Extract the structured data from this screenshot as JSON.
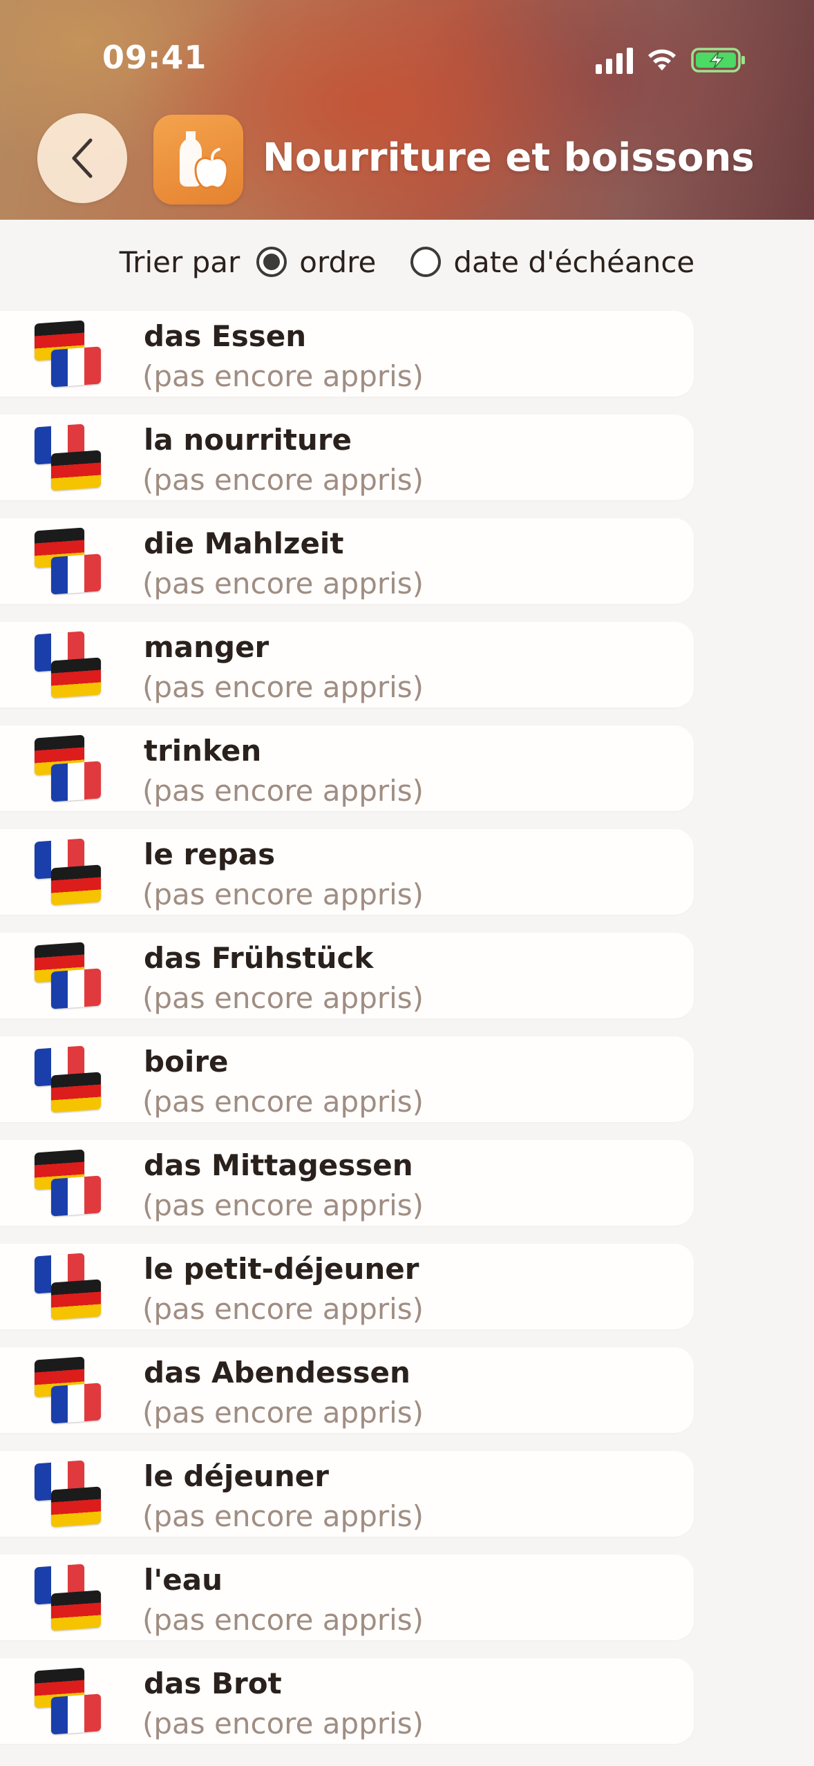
{
  "status_bar": {
    "time": "09:41"
  },
  "header": {
    "title": "Nourriture et boissons",
    "back_icon": "chevron-left-icon",
    "category_icon": "food-drink-icon"
  },
  "sort": {
    "label": "Trier par",
    "options": [
      {
        "label": "ordre",
        "selected": true
      },
      {
        "label": "date d'échéance",
        "selected": false
      }
    ]
  },
  "colors": {
    "accent_orange": "#e98a35",
    "card_bg": "#fffefd",
    "muted_text": "#a08d82"
  },
  "items": [
    {
      "word": "das Essen",
      "status": "(pas encore appris)",
      "direction": "de-fr"
    },
    {
      "word": "la nourriture",
      "status": "(pas encore appris)",
      "direction": "fr-de"
    },
    {
      "word": "die Mahlzeit",
      "status": "(pas encore appris)",
      "direction": "de-fr"
    },
    {
      "word": "manger",
      "status": "(pas encore appris)",
      "direction": "fr-de"
    },
    {
      "word": "trinken",
      "status": "(pas encore appris)",
      "direction": "de-fr"
    },
    {
      "word": "le repas",
      "status": "(pas encore appris)",
      "direction": "fr-de"
    },
    {
      "word": "das Frühstück",
      "status": "(pas encore appris)",
      "direction": "de-fr"
    },
    {
      "word": "boire",
      "status": "(pas encore appris)",
      "direction": "fr-de"
    },
    {
      "word": "das Mittagessen",
      "status": "(pas encore appris)",
      "direction": "de-fr"
    },
    {
      "word": "le petit-déjeuner",
      "status": "(pas encore appris)",
      "direction": "fr-de"
    },
    {
      "word": "das Abendessen",
      "status": "(pas encore appris)",
      "direction": "de-fr"
    },
    {
      "word": "le déjeuner",
      "status": "(pas encore appris)",
      "direction": "fr-de"
    },
    {
      "word": "l'eau",
      "status": "(pas encore appris)",
      "direction": "fr-de"
    },
    {
      "word": "das Brot",
      "status": "(pas encore appris)",
      "direction": "de-fr"
    }
  ]
}
